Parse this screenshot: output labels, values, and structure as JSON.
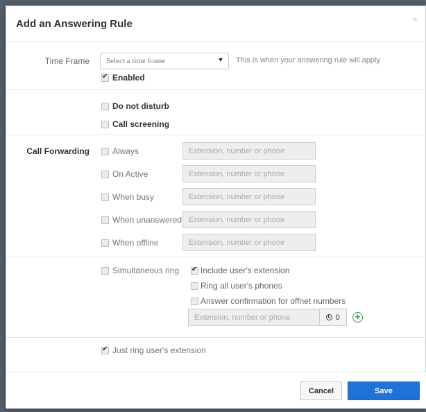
{
  "modal": {
    "title": "Add an Answering Rule",
    "close_glyph": "×"
  },
  "time_frame": {
    "label": "Time Frame",
    "select_value": "Select a time frame",
    "hint": "This is when your answering rule will apply",
    "enabled_label": "Enabled",
    "enabled_checked": true
  },
  "options": {
    "do_not_disturb": "Do not disturb",
    "call_screening": "Call screening"
  },
  "call_forwarding": {
    "label": "Call Forwarding",
    "rows": [
      {
        "label": "Always",
        "placeholder": "Extension, number or phone"
      },
      {
        "label": "On Active",
        "placeholder": "Extension, number or phone"
      },
      {
        "label": "When busy",
        "placeholder": "Extension, number or phone"
      },
      {
        "label": "When unanswered",
        "placeholder": "Extension, number or phone"
      },
      {
        "label": "When offline",
        "placeholder": "Extension, number or phone"
      }
    ]
  },
  "simultaneous": {
    "label": "Simultaneous ring",
    "include_extension": "Include user's extension",
    "include_extension_checked": true,
    "ring_all": "Ring all user's phones",
    "answer_confirmation": "Answer confirmation for offnet numbers",
    "placeholder": "Extension, number or phone",
    "delay_value": "0"
  },
  "just_ring": {
    "label": "Just ring user's extension",
    "checked": true
  },
  "footer": {
    "cancel_label": "Cancel",
    "save_label": "Save"
  },
  "colors": {
    "save_button": "#1f73d8",
    "add_icon": "#3a9a3a"
  }
}
